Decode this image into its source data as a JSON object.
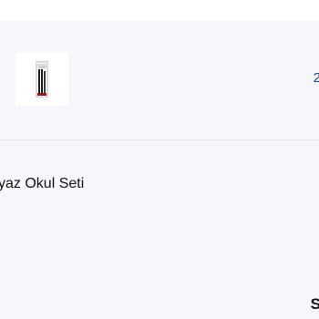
{
  "cart": {
    "item": {
      "image_icon": "pencil-set-thumbnail",
      "quantity_text": "2",
      "name_fragment": "yaz Okul Seti"
    },
    "next_heading_fragment": "S"
  },
  "colors": {
    "background": "#f6f7fb",
    "top_strip": "#ffffff",
    "divider": "#e6e8ee",
    "accent_number": "#2b4c7e",
    "text": "#111111"
  }
}
